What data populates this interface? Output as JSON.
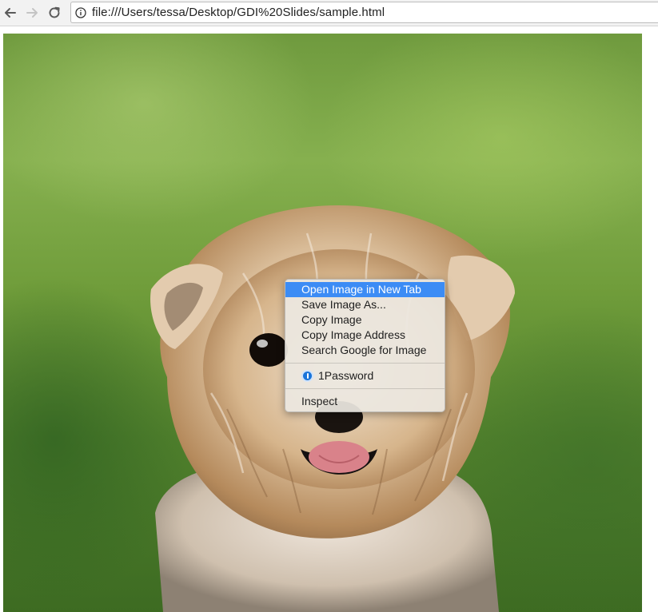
{
  "browser": {
    "url": "file:///Users/tessa/Desktop/GDI%20Slides/sample.html",
    "icons": {
      "back": "arrow-left-icon",
      "forward": "arrow-right-icon",
      "reload": "reload-icon",
      "info": "info-circle-icon"
    }
  },
  "context_menu": {
    "items": [
      {
        "label": "Open Image in New Tab",
        "highlighted": true
      },
      {
        "label": "Save Image As..."
      },
      {
        "label": "Copy Image"
      },
      {
        "label": "Copy Image Address"
      },
      {
        "label": "Search Google for Image"
      }
    ],
    "extension_item": {
      "label": "1Password",
      "icon": "1password-icon"
    },
    "inspect_item": {
      "label": "Inspect"
    },
    "highlight_color": "#3c8cf5"
  }
}
